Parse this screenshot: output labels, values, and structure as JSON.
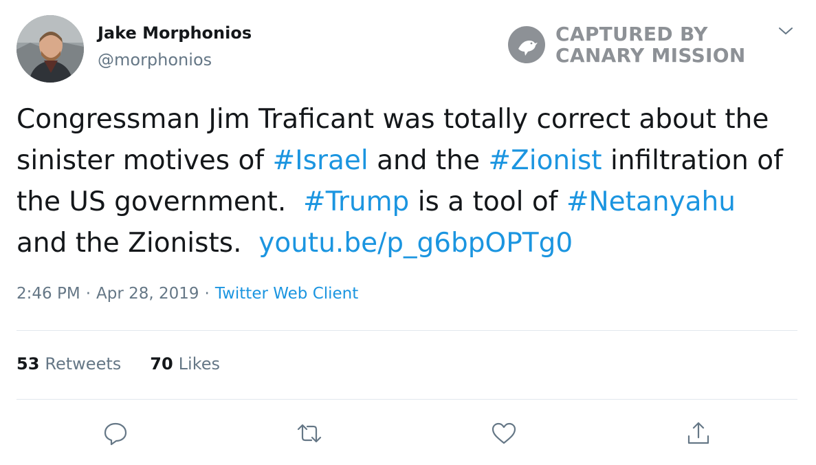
{
  "user": {
    "display_name": "Jake Morphonios",
    "handle": "@morphonios"
  },
  "watermark": {
    "line1": "CAPTURED BY",
    "line2": "CANARY MISSION"
  },
  "tweet": {
    "lines": [
      [
        {
          "text": "Congressman Jim Traficant was totally correct about the",
          "link": false
        }
      ],
      [
        {
          "text": "sinister motives of ",
          "link": false
        },
        {
          "text": "#Israel",
          "link": true
        },
        {
          "text": " and the ",
          "link": false
        },
        {
          "text": "#Zionist",
          "link": true
        },
        {
          "text": " infiltration of",
          "link": false
        }
      ],
      [
        {
          "text": "the US government.  ",
          "link": false
        },
        {
          "text": "#Trump",
          "link": true
        },
        {
          "text": " is a tool of ",
          "link": false
        },
        {
          "text": "#Netanyahu",
          "link": true
        }
      ],
      [
        {
          "text": "and the Zionists.  ",
          "link": false
        },
        {
          "text": "youtu.be/p_g6bpOPTg0",
          "link": true
        }
      ]
    ]
  },
  "meta": {
    "time": "2:46 PM",
    "separator": "·",
    "date": "Apr 28, 2019",
    "source": "Twitter Web Client"
  },
  "stats": {
    "retweets_count": "53",
    "retweets_label": "Retweets",
    "likes_count": "70",
    "likes_label": "Likes"
  },
  "icons": {
    "reply": "reply-icon",
    "retweet": "retweet-icon",
    "like": "heart-icon",
    "share": "share-icon",
    "menu": "chevron-down-icon",
    "watermark_logo": "canary-bird-icon"
  },
  "colors": {
    "link": "#1b95e0",
    "secondary_text": "#657786",
    "primary_text": "#14171a",
    "divider": "#e1e8ed",
    "watermark": "#8d9196"
  }
}
